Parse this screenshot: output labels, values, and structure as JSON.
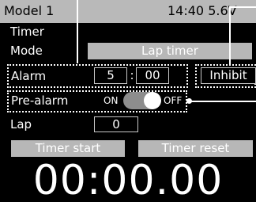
{
  "header": {
    "model": "Model 1",
    "status": "14:40 5.6V"
  },
  "screen_title": "Timer",
  "mode": {
    "label": "Mode",
    "value": "Lap timer"
  },
  "alarm": {
    "label": "Alarm",
    "minutes": "5",
    "separator": ":",
    "seconds": "00",
    "inhibit_label": "Inhibit"
  },
  "pre_alarm": {
    "label": "Pre-alarm",
    "on_label": "ON",
    "off_label": "OFF",
    "state": "off"
  },
  "lap": {
    "label": "Lap",
    "value": "0"
  },
  "buttons": {
    "start": "Timer start",
    "reset": "Timer reset"
  },
  "timer_display": "00:00.00",
  "colors": {
    "background": "#000000",
    "title_bar": "#b9b9b9",
    "button": "#b7b7b7",
    "text": "#ffffff"
  }
}
